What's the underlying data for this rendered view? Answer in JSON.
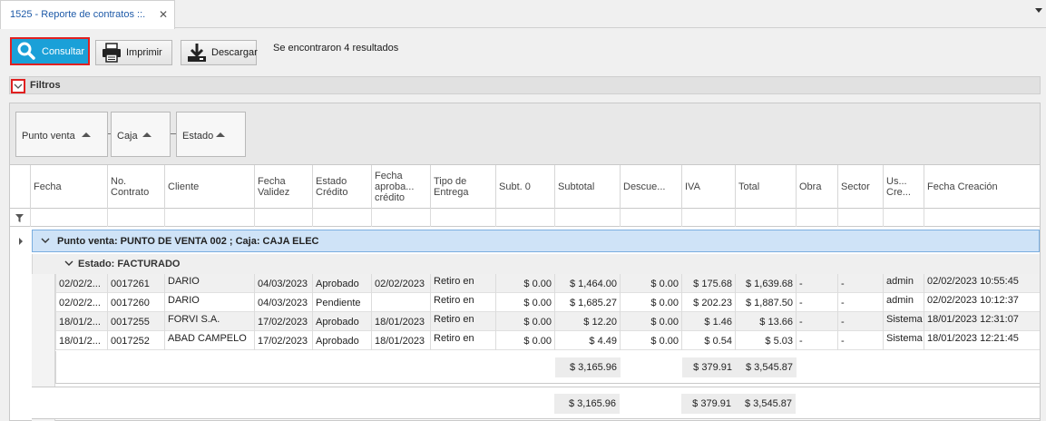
{
  "tab": {
    "title": "1525 - Reporte de contratos ::.",
    "close": "✕"
  },
  "toolbar": {
    "consultar": "Consultar",
    "imprimir": "Imprimir",
    "descargar": "Descargar",
    "result_text": "Se encontraron 4 resultados"
  },
  "filtros": {
    "label": "Filtros"
  },
  "group_panel": {
    "chips": [
      "Punto venta",
      "Caja",
      "Estado"
    ]
  },
  "columns": [
    "Fecha",
    "No.\nContrato",
    "Cliente",
    "Fecha\nValidez",
    "Estado\nCrédito",
    "Fecha\naproba...\ncrédito",
    "Tipo de\nEntrega",
    "Subt. 0",
    "Subtotal",
    "Descue...",
    "IVA",
    "Total",
    "Obra",
    "Sector",
    "Us...\nCre...",
    "Fecha Creación"
  ],
  "group1": {
    "label": "Punto venta: PUNTO DE VENTA 002 ; Caja: CAJA ELEC"
  },
  "group2": {
    "label": "Estado: FACTURADO"
  },
  "rows": [
    [
      "02/02/2...",
      "0017261",
      "DARIO",
      "04/03/2023",
      "Aprobado",
      "02/02/2023",
      "Retiro en",
      "$ 0.00",
      "$ 1,464.00",
      "$ 0.00",
      "$ 175.68",
      "$ 1,639.68",
      "-",
      "-",
      "admin",
      "02/02/2023 10:55:45"
    ],
    [
      "02/02/2...",
      "0017260",
      "DARIO",
      "04/03/2023",
      "Pendiente",
      "",
      "Retiro en",
      "$ 0.00",
      "$ 1,685.27",
      "$ 0.00",
      "$ 202.23",
      "$ 1,887.50",
      "-",
      "-",
      "admin",
      "02/02/2023 10:12:37"
    ],
    [
      "18/01/2...",
      "0017255",
      "FORVI S.A.",
      "17/02/2023",
      "Aprobado",
      "18/01/2023",
      "Retiro en",
      "$ 0.00",
      "$ 12.20",
      "$ 0.00",
      "$ 1.46",
      "$ 13.66",
      "-",
      "-",
      "Sistema",
      "18/01/2023 12:31:07"
    ],
    [
      "18/01/2...",
      "0017252",
      "ABAD CAMPELO",
      "17/02/2023",
      "Aprobado",
      "18/01/2023",
      "Retiro en",
      "$ 0.00",
      "$ 4.49",
      "$ 0.00",
      "$ 0.54",
      "$ 5.03",
      "-",
      "-",
      "Sistema",
      "18/01/2023 12:21:45"
    ]
  ],
  "group_summary": {
    "subtotal": "$ 3,165.96",
    "iva": "$ 379.91",
    "total": "$ 3,545.87"
  },
  "grand_summary": {
    "subtotal": "$ 3,165.96",
    "iva": "$ 379.91",
    "total": "$ 3,545.87"
  },
  "colors": {
    "accent": "#1aa0d8",
    "highlight_border": "#e02020",
    "group_row": "#cfe3f7"
  }
}
